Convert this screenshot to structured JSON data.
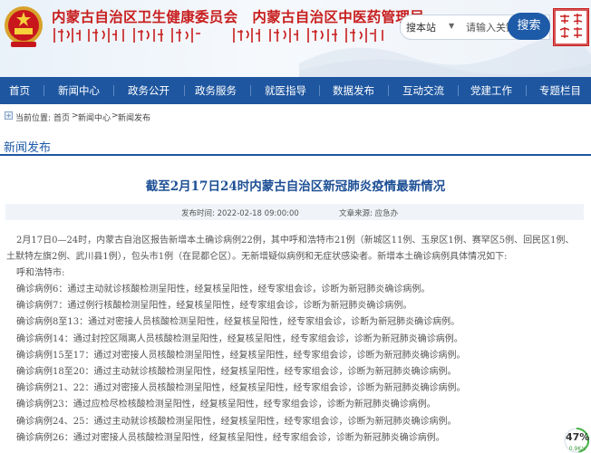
{
  "header": {
    "title_left": "内蒙古自治区卫生健康委员会",
    "title_right": "内蒙古自治区中医药管理局",
    "search": {
      "scope": "搜本站",
      "placeholder": "请输入关键字",
      "button": "搜索"
    }
  },
  "nav": [
    "首页",
    "新闻中心",
    "政务公开",
    "政务服务",
    "就医指导",
    "数据发布",
    "互动交流",
    "党建工作",
    "专题栏目"
  ],
  "breadcrumb": {
    "prefix": "当前位置:",
    "items": [
      "首页",
      ">",
      "新闻中心",
      ">",
      "新闻发布"
    ]
  },
  "section_title": "新闻发布",
  "article": {
    "title": "截至2月17日24时内蒙古自治区新冠肺炎疫情最新情况",
    "publish_time": "发布时间:   2022-02-18 09:00:00",
    "source": "文章来源:    应急办",
    "lines": [
      "2月17日0—24时，内蒙古自治区报告新增本土确诊病例22例，其中呼和浩特市21例（新城区11例、玉泉区1例、赛罕区5例、回民区1例、",
      "土默特左旗2例、武川县1例），包头市1例（在昆都仑区）。无新增疑似病例和无症状感染者。新增本土确诊病例具体情况如下:",
      "呼和浩特市:",
      "确诊病例6：通过主动就诊核酸检测呈阳性，经复核呈阳性，经专家组会诊，诊断为新冠肺炎确诊病例。",
      "确诊病例7：通过例行核酸检测呈阳性，经复核呈阳性，经专家组会诊，诊断为新冠肺炎确诊病例。",
      "确诊病例8至13：通过对密接人员核酸检测呈阳性，经复核呈阳性，经专家组会诊，诊断为新冠肺炎确诊病例。",
      "确诊病例14：通过封控区隔离人员核酸检测呈阳性，经复核呈阳性，经专家组会诊，诊断为新冠肺炎确诊病例。",
      "确诊病例15至17：通过对密接人员核酸检测呈阳性，经复核呈阳性，经专家组会诊，诊断为新冠肺炎确诊病例。",
      "确诊病例18至20：通过主动就诊核酸检测呈阳性，经复核呈阳性，经专家组会诊，诊断为新冠肺炎确诊病例。",
      "确诊病例21、22：通过对密接人员核酸检测呈阳性，经复核呈阳性，经专家组会诊，诊断为新冠肺炎确诊病例。",
      "确诊病例23：通过应检尽检核酸检测呈阳性，经复核呈阳性，经专家组会诊，诊断为新冠肺炎确诊病例。",
      "确诊病例24、25：通过主动就诊核酸检测呈阳性，经复核呈阳性，经专家组会诊，诊断为新冠肺炎确诊病例。",
      "确诊病例26：通过对密接人员核酸检测呈阳性，经复核呈阳性，经专家组会诊，诊断为新冠肺炎确诊病例。"
    ]
  },
  "badge": {
    "percent": "47%",
    "speed": "0.9K/s"
  },
  "colors": {
    "brand_blue": "#1e56a0",
    "title_red": "#c81d1d"
  }
}
